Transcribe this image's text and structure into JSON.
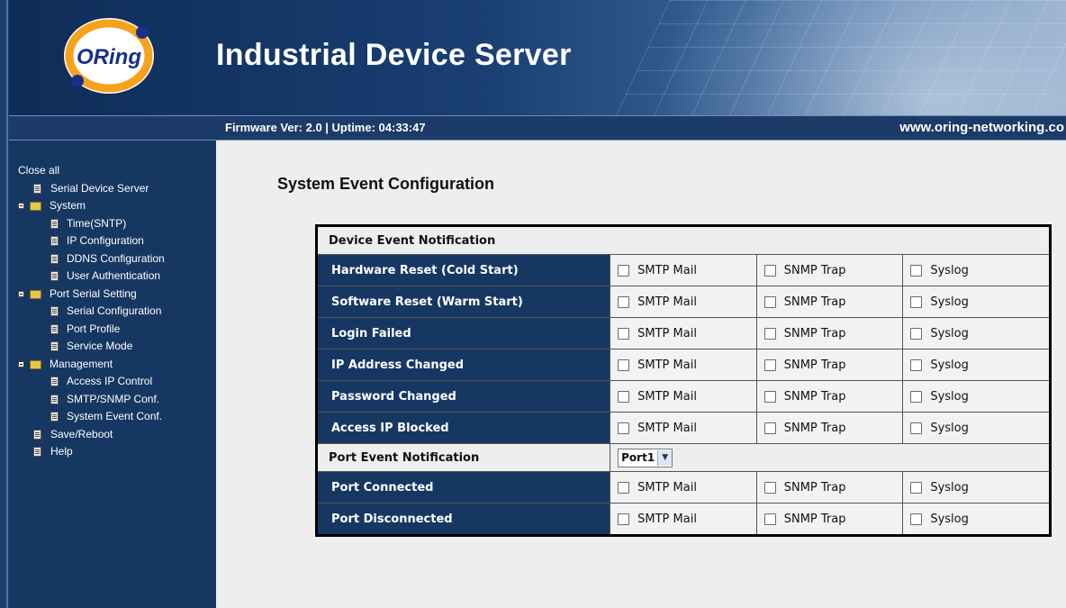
{
  "header": {
    "logo_text": "ORing",
    "title": "Industrial Device Server",
    "firmware": "Firmware Ver: 2.0 | Uptime: 04:33:47",
    "website": "www.oring-networking.co"
  },
  "sidebar": {
    "close_all": "Close all",
    "items": [
      {
        "label": "Serial Device Server",
        "icon": "document-icon",
        "level": 1
      },
      {
        "label": "System",
        "icon": "folder-icon",
        "level": 0
      },
      {
        "label": "Time(SNTP)",
        "icon": "document-icon",
        "level": 2
      },
      {
        "label": "IP Configuration",
        "icon": "document-icon",
        "level": 2
      },
      {
        "label": "DDNS Configuration",
        "icon": "document-icon",
        "level": 2
      },
      {
        "label": "User Authentication",
        "icon": "document-icon",
        "level": 2
      },
      {
        "label": "Port Serial Setting",
        "icon": "folder-icon",
        "level": 0
      },
      {
        "label": "Serial Configuration",
        "icon": "document-icon",
        "level": 2
      },
      {
        "label": "Port Profile",
        "icon": "document-icon",
        "level": 2
      },
      {
        "label": "Service Mode",
        "icon": "document-icon",
        "level": 2
      },
      {
        "label": "Management",
        "icon": "folder-icon",
        "level": 0
      },
      {
        "label": "Access IP Control",
        "icon": "document-icon",
        "level": 2
      },
      {
        "label": "SMTP/SNMP Conf.",
        "icon": "document-icon",
        "level": 2
      },
      {
        "label": "System Event Conf.",
        "icon": "document-icon",
        "level": 2
      },
      {
        "label": "Save/Reboot",
        "icon": "document-icon",
        "level": 1
      },
      {
        "label": "Help",
        "icon": "document-icon",
        "level": 1
      }
    ]
  },
  "main": {
    "page_title": "System Event Configuration",
    "device_section": "Device Event Notification",
    "port_section": "Port Event Notification",
    "port_select": {
      "value": "Port1"
    },
    "option_labels": {
      "smtp": "SMTP Mail",
      "snmp": "SNMP Trap",
      "syslog": "Syslog"
    },
    "device_events": [
      {
        "label": "Hardware Reset (Cold Start)",
        "smtp": false,
        "snmp": false,
        "syslog": false
      },
      {
        "label": "Software Reset (Warm Start)",
        "smtp": false,
        "snmp": false,
        "syslog": false
      },
      {
        "label": "Login Failed",
        "smtp": false,
        "snmp": false,
        "syslog": false
      },
      {
        "label": "IP Address Changed",
        "smtp": false,
        "snmp": false,
        "syslog": false
      },
      {
        "label": "Password Changed",
        "smtp": false,
        "snmp": false,
        "syslog": false
      },
      {
        "label": "Access IP Blocked",
        "smtp": false,
        "snmp": false,
        "syslog": false
      }
    ],
    "port_events": [
      {
        "label": "Port Connected",
        "smtp": false,
        "snmp": false,
        "syslog": false
      },
      {
        "label": "Port Disconnected",
        "smtp": false,
        "snmp": false,
        "syslog": false
      }
    ]
  }
}
